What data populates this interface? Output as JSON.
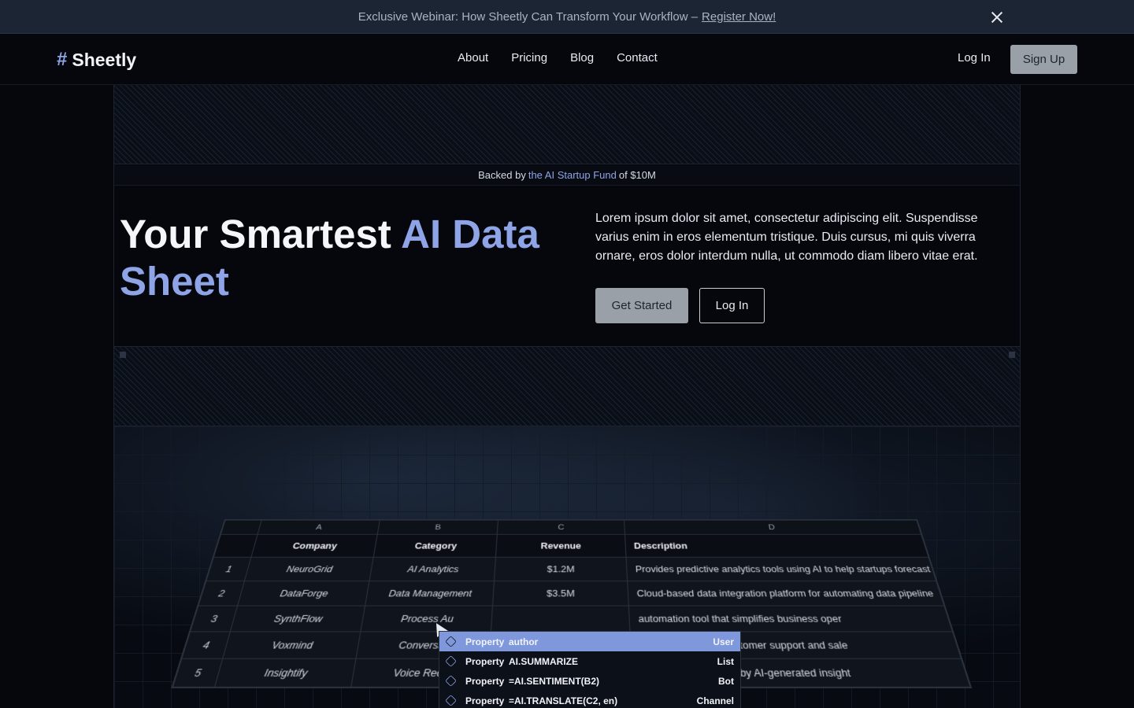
{
  "announcement": {
    "text": "Exclusive Webinar: How Sheetly Can Transform Your Workflow –",
    "link": "Register Now!"
  },
  "nav": {
    "brand": "Sheetly",
    "brand_icon": "hash-icon",
    "links": [
      "About",
      "Pricing",
      "Blog",
      "Contact"
    ],
    "login": "Log In",
    "signup": "Sign Up"
  },
  "backed": {
    "prefix": "Backed by",
    "highlight": "the AI Startup Fund",
    "suffix": "of $10M"
  },
  "hero": {
    "title_plain": "Your Smartest",
    "title_accent": "AI Data Sheet",
    "description": "Lorem ipsum dolor sit amet, consectetur adipiscing elit. Suspendisse varius enim in eros elementum tristique. Duis cursus, mi quis viverra ornare, eros dolor interdum nulla, ut commodo diam libero vitae erat.",
    "cta_primary": "Get Started",
    "cta_secondary": "Log In"
  },
  "sheet": {
    "columns": [
      "A",
      "B",
      "C",
      "D"
    ],
    "headers": [
      "Company",
      "Category",
      "Revenue",
      "Description"
    ],
    "rows": [
      {
        "n": "1",
        "company": "NeuroGrid",
        "category": "AI Analytics",
        "revenue": "$1.2M",
        "description": "Provides predictive analytics tools using AI to help startups forecast"
      },
      {
        "n": "2",
        "company": "DataForge",
        "category": "Data Management",
        "revenue": "$3.5M",
        "description": "Cloud-based data integration platform for automating data pipeline"
      },
      {
        "n": "3",
        "company": "SynthFlow",
        "category": "Process Au",
        "revenue": "",
        "description": "automation tool that simplifies business oper"
      },
      {
        "n": "4",
        "company": "Voxmind",
        "category": "Conversati",
        "revenue": "",
        "description": "atbot systems for customer support and sale"
      },
      {
        "n": "5",
        "company": "Insightify",
        "category": "Voice Reco",
        "revenue": "",
        "description": "dashboard powered by AI-generated insight"
      }
    ]
  },
  "popup": {
    "items": [
      {
        "key": "Property",
        "value": "author",
        "type": "User"
      },
      {
        "key": "Property",
        "value": "AI.SUMMARIZE",
        "type": "List"
      },
      {
        "key": "Property",
        "value": "=AI.SENTIMENT(B2)",
        "type": "Bot"
      },
      {
        "key": "Property",
        "value": "=AI.TRANSLATE(C2, en)",
        "type": "Channel"
      }
    ]
  },
  "colors": {
    "accent": "#8ea4e6",
    "background": "#05070d",
    "button_gray": "#9aa0a8"
  }
}
